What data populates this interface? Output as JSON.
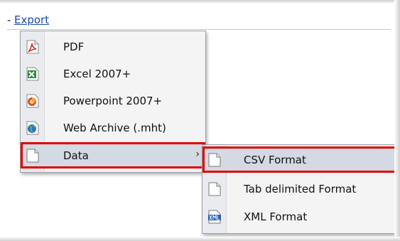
{
  "header": {
    "dash": "-",
    "export_label": "Export"
  },
  "main_menu": {
    "items": [
      {
        "label": "PDF",
        "icon": "pdf-icon"
      },
      {
        "label": "Excel 2007+",
        "icon": "excel-icon"
      },
      {
        "label": "Powerpoint 2007+",
        "icon": "powerpoint-icon"
      },
      {
        "label": "Web Archive (.mht)",
        "icon": "web-archive-icon"
      },
      {
        "label": "Data",
        "icon": "document-icon",
        "has_submenu": true,
        "submenu_arrow": "›",
        "highlighted": true
      }
    ]
  },
  "data_submenu": {
    "items": [
      {
        "label": "CSV Format",
        "icon": "document-icon",
        "highlighted": true
      },
      {
        "label": "Tab delimited Format",
        "icon": "document-icon"
      },
      {
        "label": "XML Format",
        "icon": "xml-icon"
      }
    ]
  },
  "colors": {
    "highlight_border": "#e00000",
    "selected_bg": "#d3dae3",
    "link": "#1d4aa7"
  }
}
